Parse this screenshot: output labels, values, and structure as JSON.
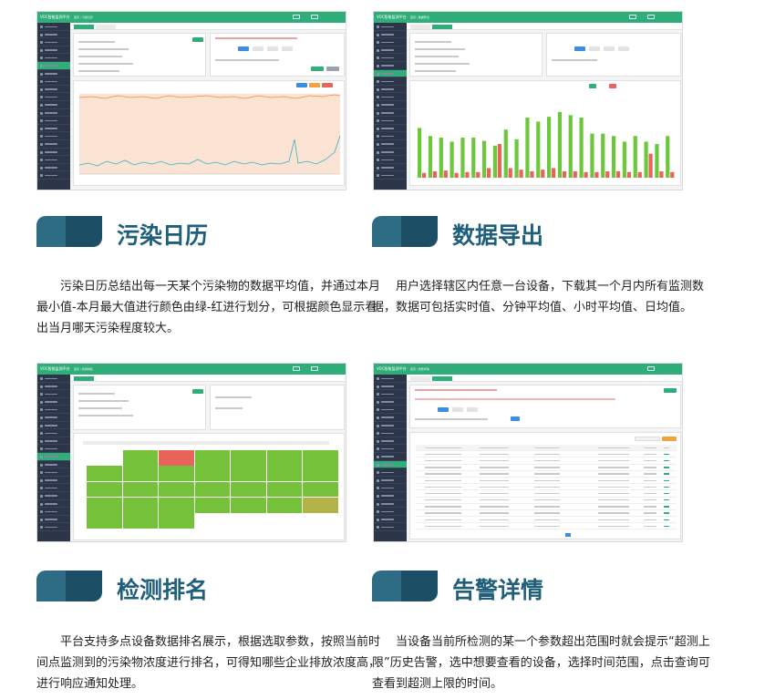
{
  "shots": [
    {
      "brand": "VOC智能监测平台",
      "crumb": "首页 / 污染日历"
    },
    {
      "brand": "VOC智能监测平台",
      "crumb": "首页 / 数据导出"
    },
    {
      "brand": "VOC智能监测平台",
      "crumb": "首页 / 检测排名"
    },
    {
      "brand": "VOC智能监测平台",
      "crumb": "首页 / 告警详情"
    }
  ],
  "features": [
    {
      "title": "污染日历",
      "description": "　　污染日历总结出每一天某个污染物的数据平均值，并通过本月最小值-本月最大值进行颜色由绿-红进行划分，可根据颜色显示看出当月哪天污染程度较大。"
    },
    {
      "title": "数据导出",
      "description": "　　用户选择辖区内任意一台设备，下载其一个月内所有监测数据，数据可包括实时值、分钟平均值、小时平均值、日均值。"
    },
    {
      "title": "检测排名",
      "description": "　　平台支持多点设备数据排名展示，根据选取参数，按照当前时间点监测到的污染物浓度进行排名，可得知哪些企业排放浓度高，进行响应通知处理。"
    },
    {
      "title": "告警详情",
      "description": "　　当设备当前所检测的某一个参数超出范围时就会提示“超测上限”历史告警，选中想要查看的设备，选择时间范围，点击查询可查看到超测上限的时间。"
    }
  ],
  "colors": {
    "accent": "#2fae79",
    "title": "#1f5f7a",
    "bar_green": "#6cc73a",
    "bar_red": "#e8645a"
  }
}
